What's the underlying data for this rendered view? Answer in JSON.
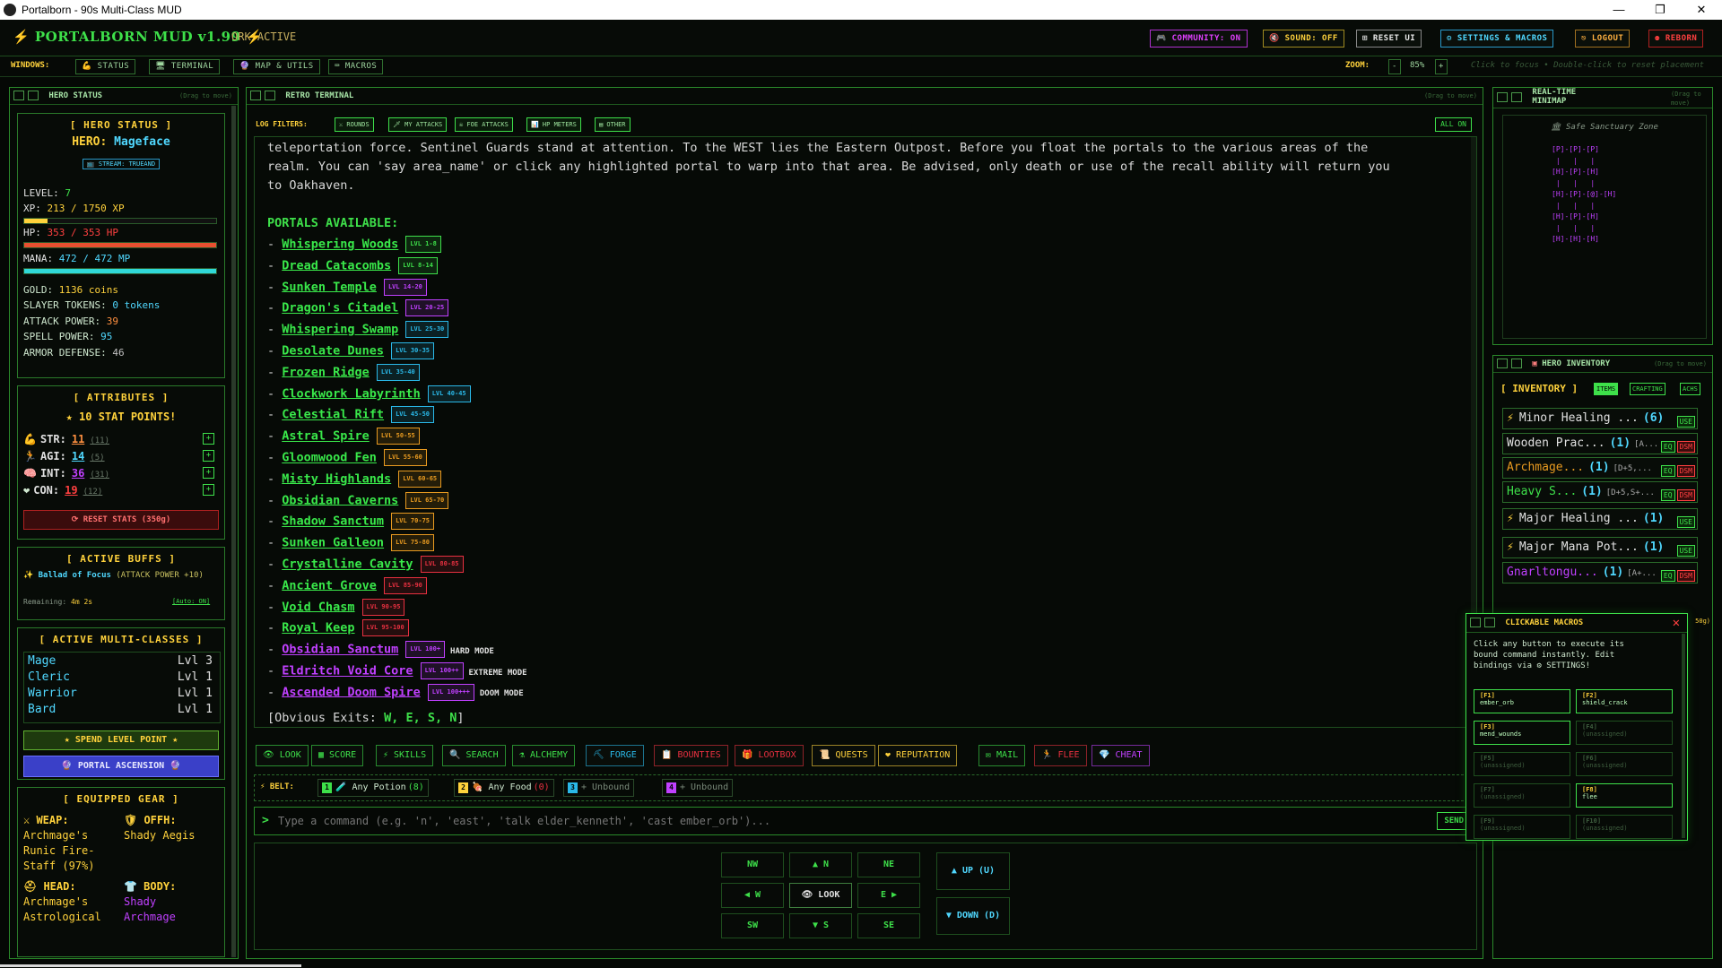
{
  "os": {
    "window_title": "Portalborn - 90s Multi-Class MUD",
    "minimize": "—",
    "maximize": "❐",
    "close": "✕"
  },
  "header": {
    "title": "⚡ PORTALBORN MUD v1.99 ⚡",
    "ork_status": "ORK ACTIVE",
    "buttons": {
      "community": "🎮 COMMUNITY: ON",
      "sound": "🔇 SOUND: OFF",
      "reset_ui": "⊞ RESET UI",
      "settings": "⚙ SETTINGS & MACROS",
      "logout": "⎋ LOGOUT",
      "reborn": "⚉ REBORN"
    }
  },
  "windows_bar": {
    "label": "WINDOWS:",
    "items": [
      "💪 STATUS",
      "🖥 TERMINAL",
      "🔮 MAP & UTILS",
      "⌨ MACROS"
    ],
    "zoom_label": "ZOOM:",
    "zoom_value": "85%",
    "zoom_minus": "-",
    "zoom_plus": "+",
    "hint": "Click to focus • Double-click to reset placement"
  },
  "hero_panel": {
    "title": "HERO STATUS",
    "drag": "(Drag to move)",
    "section": "[ HERO STATUS ]",
    "hero_label": "HERO:",
    "hero_name": "Mageface",
    "stream": "📺 STREAM: TRUEAND",
    "level_label": "LEVEL:",
    "level": "7",
    "xp_label": "XP:",
    "xp": "213 / 1750 XP",
    "xp_fill": 0.12,
    "hp_label": "HP:",
    "hp": "353 / 353 HP",
    "hp_fill": 1.0,
    "mana_label": "MANA:",
    "mana": "472 / 472 MP",
    "mana_fill": 1.0,
    "gold_label": "GOLD:",
    "gold": "1136 coins",
    "slayer_label": "SLAYER TOKENS:",
    "slayer": "0 tokens",
    "attack_label": "ATTACK POWER:",
    "attack": "39",
    "spell_label": "SPELL POWER:",
    "spell": "95",
    "armor_label": "ARMOR DEFENSE:",
    "armor": "46"
  },
  "attributes": {
    "section": "[ ATTRIBUTES ]",
    "points": "★ 10 STAT POINTS!",
    "stats": [
      {
        "icon": "💪",
        "label": "STR:",
        "value": "11",
        "base": "(11)"
      },
      {
        "icon": "🏃",
        "label": "AGI:",
        "value": "14",
        "base": "(5)"
      },
      {
        "icon": "🧠",
        "label": "INT:",
        "value": "36",
        "base": "(31)"
      },
      {
        "icon": "❤",
        "label": "CON:",
        "value": "19",
        "base": "(12)"
      }
    ],
    "plus": "+",
    "reset": "⟳ RESET STATS (350g)"
  },
  "buffs": {
    "section": "[ ACTIVE BUFFS ]",
    "name": "✨ Ballad of Focus",
    "effect": "(ATTACK POWER +10)",
    "remaining_label": "Remaining:",
    "remaining": "4m 2s",
    "auto": "[Auto: ON]"
  },
  "multiclass": {
    "section": "[ ACTIVE MULTI-CLASSES ]",
    "classes": [
      {
        "name": "Mage",
        "lvl": "Lvl 3"
      },
      {
        "name": "Cleric",
        "lvl": "Lvl 1"
      },
      {
        "name": "Warrior",
        "lvl": "Lvl 1"
      },
      {
        "name": "Bard",
        "lvl": "Lvl 1"
      }
    ],
    "spend": "★ SPEND LEVEL POINT ★",
    "ascension": "🔮 PORTAL ASCENSION 🔮"
  },
  "gear": {
    "section": "[ EQUIPPED GEAR ]",
    "weap_label": "⚔ WEAP:",
    "weap_1": "Archmage's",
    "weap_2": "Runic Fire-",
    "weap_3": "Staff (97%)",
    "offh_label": "🛡 OFFH:",
    "offh": "Shady Aegis",
    "head_label": "⛑ HEAD:",
    "head_1": "Archmage's",
    "head_2": "Astrological",
    "body_label": "👕 BODY:",
    "body_1": "Shady",
    "body_2": "Archmage"
  },
  "terminal": {
    "title": "RETRO TERMINAL",
    "drag": "(Drag to move)",
    "filters_label": "LOG FILTERS:",
    "filters": [
      "⚔ ROUNDS",
      "🗡 MY ATTACKS",
      "☠ FOE ATTACKS",
      "📊 HP METERS",
      "▤ OTHER"
    ],
    "all_on": "ALL ON",
    "intro": [
      "teleportation force. Sentinel Guards stand at attention. To the WEST lies the Eastern Outpost. Before you float the portals to the various areas of the",
      "realm. You can 'say area_name' or click any highlighted portal to warp into that area. Be advised, only death or use of the recall ability will return you",
      "to Oakhaven."
    ],
    "portals_heading": "PORTALS AVAILABLE:",
    "portals": [
      {
        "name": "Whispering Woods",
        "lvl": "LVL 1-8",
        "c": "#3ee04a",
        "mode": ""
      },
      {
        "name": "Dread Catacombs",
        "lvl": "LVL 8-14",
        "c": "#3ee04a",
        "mode": ""
      },
      {
        "name": "Sunken Temple",
        "lvl": "LVL 14-20",
        "c": "#c040ff",
        "mode": ""
      },
      {
        "name": "Dragon's Citadel",
        "lvl": "LVL 20-25",
        "c": "#c040ff",
        "mode": ""
      },
      {
        "name": "Whispering Swamp",
        "lvl": "LVL 25-30",
        "c": "#2ab8e8",
        "mode": ""
      },
      {
        "name": "Desolate Dunes",
        "lvl": "LVL 30-35",
        "c": "#2ab8e8",
        "mode": ""
      },
      {
        "name": "Frozen Ridge",
        "lvl": "LVL 35-40",
        "c": "#2ab8e8",
        "mode": ""
      },
      {
        "name": "Clockwork Labyrinth",
        "lvl": "LVL 40-45",
        "c": "#2ab8e8",
        "mode": ""
      },
      {
        "name": "Celestial Rift",
        "lvl": "LVL 45-50",
        "c": "#2ab8e8",
        "mode": ""
      },
      {
        "name": "Astral Spire",
        "lvl": "LVL 50-55",
        "c": "#e89a20",
        "mode": ""
      },
      {
        "name": "Gloomwood Fen",
        "lvl": "LVL 55-60",
        "c": "#e89a20",
        "mode": ""
      },
      {
        "name": "Misty Highlands",
        "lvl": "LVL 60-65",
        "c": "#e89a20",
        "mode": ""
      },
      {
        "name": "Obsidian Caverns",
        "lvl": "LVL 65-70",
        "c": "#e89a20",
        "mode": ""
      },
      {
        "name": "Shadow Sanctum",
        "lvl": "LVL 70-75",
        "c": "#e89a20",
        "mode": ""
      },
      {
        "name": "Sunken Galleon",
        "lvl": "LVL 75-80",
        "c": "#e89a20",
        "mode": ""
      },
      {
        "name": "Crystalline Cavity",
        "lvl": "LVL 80-85",
        "c": "#e83040",
        "mode": ""
      },
      {
        "name": "Ancient Grove",
        "lvl": "LVL 85-90",
        "c": "#e83040",
        "mode": ""
      },
      {
        "name": "Void Chasm",
        "lvl": "LVL 90-95",
        "c": "#e83040",
        "mode": ""
      },
      {
        "name": "Royal Keep",
        "lvl": "LVL 95-100",
        "c": "#e83040",
        "mode": ""
      },
      {
        "name": "Obsidian Sanctum",
        "lvl": "LVL 100+",
        "c": "#c040ff",
        "mode": "HARD MODE"
      },
      {
        "name": "Eldritch Void Core",
        "lvl": "LVL 100++",
        "c": "#c040ff",
        "mode": "EXTREME MODE"
      },
      {
        "name": "Ascended Doom Spire",
        "lvl": "LVL 100+++",
        "c": "#c040ff",
        "mode": "DOOM MODE"
      }
    ],
    "exits_prefix": "[Obvious Exits:",
    "exits": "W, E, S, N",
    "exits_suffix": "]",
    "actions": [
      {
        "label": "👁 LOOK",
        "c": "#3ee04a"
      },
      {
        "label": "▦ SCORE",
        "c": "#3ee04a"
      },
      {
        "label": "⚡ SKILLS",
        "c": "#3ee04a"
      },
      {
        "label": "🔍 SEARCH",
        "c": "#3ee04a"
      },
      {
        "label": "⚗ ALCHEMY",
        "c": "#3ee04a"
      },
      {
        "label": "⛏ FORGE",
        "c": "#2ab8e8"
      },
      {
        "label": "📋 BOUNTIES",
        "c": "#e83040"
      },
      {
        "label": "🎁 LOOTBOX",
        "c": "#e83040"
      },
      {
        "label": "📜 QUESTS",
        "c": "#ffd23c"
      },
      {
        "label": "❤ REPUTATION",
        "c": "#ffd23c"
      },
      {
        "label": "✉ MAIL",
        "c": "#3ee04a"
      },
      {
        "label": "🏃 FLEE",
        "c": "#e83040"
      },
      {
        "label": "💎 CHEAT",
        "c": "#c040ff"
      }
    ],
    "belt_label": "⚡ BELT:",
    "belt": [
      {
        "key": "1",
        "text": "🧪 Any Potion",
        "count": "(8)",
        "kc": "#3ee04a"
      },
      {
        "key": "2",
        "text": "🍖 Any Food",
        "count": "(0)",
        "kc": "#ffd23c"
      },
      {
        "key": "3",
        "text": "+ Unbound",
        "count": "",
        "kc": "#2ab8e8"
      },
      {
        "key": "4",
        "text": "+ Unbound",
        "count": "",
        "kc": "#c040ff"
      }
    ],
    "prompt": ">",
    "placeholder": "Type a command (e.g. 'n', 'east', 'talk elder_kenneth', 'cast ember_orb')...",
    "send": "SEND",
    "nav": {
      "nw": "NW",
      "n": "▲ N",
      "ne": "NE",
      "w": "◀ W",
      "look": "👁 LOOK",
      "e": "E ▶",
      "sw": "SW",
      "s": "▼ S",
      "se": "SE",
      "up": "▲ UP (U)",
      "down": "▼ DOWN (D)"
    }
  },
  "minimap": {
    "title": "REAL-TIME MINIMAP",
    "drag": "(Drag to move)",
    "zone": "🏛 Safe Sanctuary Zone",
    "rows": [
      "[P]-[P]-[P]",
      " |   |   | ",
      "[H]-[P]-[H]",
      " |   |   | ",
      "[H]-[P]-[@]-[H]",
      " |   |   | ",
      "[H]-[P]-[H]",
      " |   |   | ",
      "[H]-[H]-[H]"
    ]
  },
  "inventory": {
    "title": "HERO INVENTORY",
    "drag": "(Drag to move)",
    "heading": "[ INVENTORY ]",
    "tabs": [
      "ITEMS",
      "CRAFTING",
      "ACHS"
    ],
    "items": [
      {
        "icon": "⚡",
        "name": "Minor Healing ...",
        "qty": "(6)",
        "extra": "",
        "c": "#e0e0e0",
        "btns": [
          "USE"
        ]
      },
      {
        "icon": "",
        "name": "Wooden Prac...",
        "qty": "(1)",
        "extra": "[A...",
        "c": "#e0e0e0",
        "btns": [
          "EQ",
          "DSM"
        ]
      },
      {
        "icon": "",
        "name": "Archmage...",
        "qty": "(1)",
        "extra": "[D+5,...",
        "c": "#e89a20",
        "btns": [
          "EQ",
          "DSM"
        ]
      },
      {
        "icon": "",
        "name": "Heavy S...",
        "qty": "(1)",
        "extra": "[D+5,S+...",
        "c": "#3ee04a",
        "btns": [
          "EQ",
          "DSM"
        ]
      },
      {
        "icon": "⚡",
        "name": "Major Healing ...",
        "qty": "(1)",
        "extra": "",
        "c": "#e0e0e0",
        "btns": [
          "USE"
        ]
      },
      {
        "icon": "⚡",
        "name": "Major Mana Pot...",
        "qty": "(1)",
        "extra": "",
        "c": "#e0e0e0",
        "btns": [
          "USE"
        ]
      },
      {
        "icon": "",
        "name": "Gnarltongu...",
        "qty": "(1)",
        "extra": "[A+...",
        "c": "#c040ff",
        "btns": [
          "EQ",
          "DSM"
        ]
      }
    ],
    "peek": "50g)"
  },
  "macros": {
    "title": "CLICKABLE MACROS",
    "close": "✕",
    "desc_1": "Click any button to execute its",
    "desc_2": "bound command instantly. Edit",
    "desc_3": "bindings via ⚙ SETTINGS!",
    "slots": [
      {
        "key": "[F1]",
        "cmd": "ember_orb",
        "on": true
      },
      {
        "key": "[F2]",
        "cmd": "shield_crack",
        "on": true
      },
      {
        "key": "[F3]",
        "cmd": "mend_wounds",
        "on": true
      },
      {
        "key": "[F4]",
        "cmd": "(unassigned)",
        "on": false
      },
      {
        "key": "[F5]",
        "cmd": "(unassigned)",
        "on": false
      },
      {
        "key": "[F6]",
        "cmd": "(unassigned)",
        "on": false
      },
      {
        "key": "[F7]",
        "cmd": "(unassigned)",
        "on": false
      },
      {
        "key": "[F8]",
        "cmd": "flee",
        "on": true
      },
      {
        "key": "[F9]",
        "cmd": "(unassigned)",
        "on": false
      },
      {
        "key": "[F10]",
        "cmd": "(unassigned)",
        "on": false
      }
    ]
  }
}
